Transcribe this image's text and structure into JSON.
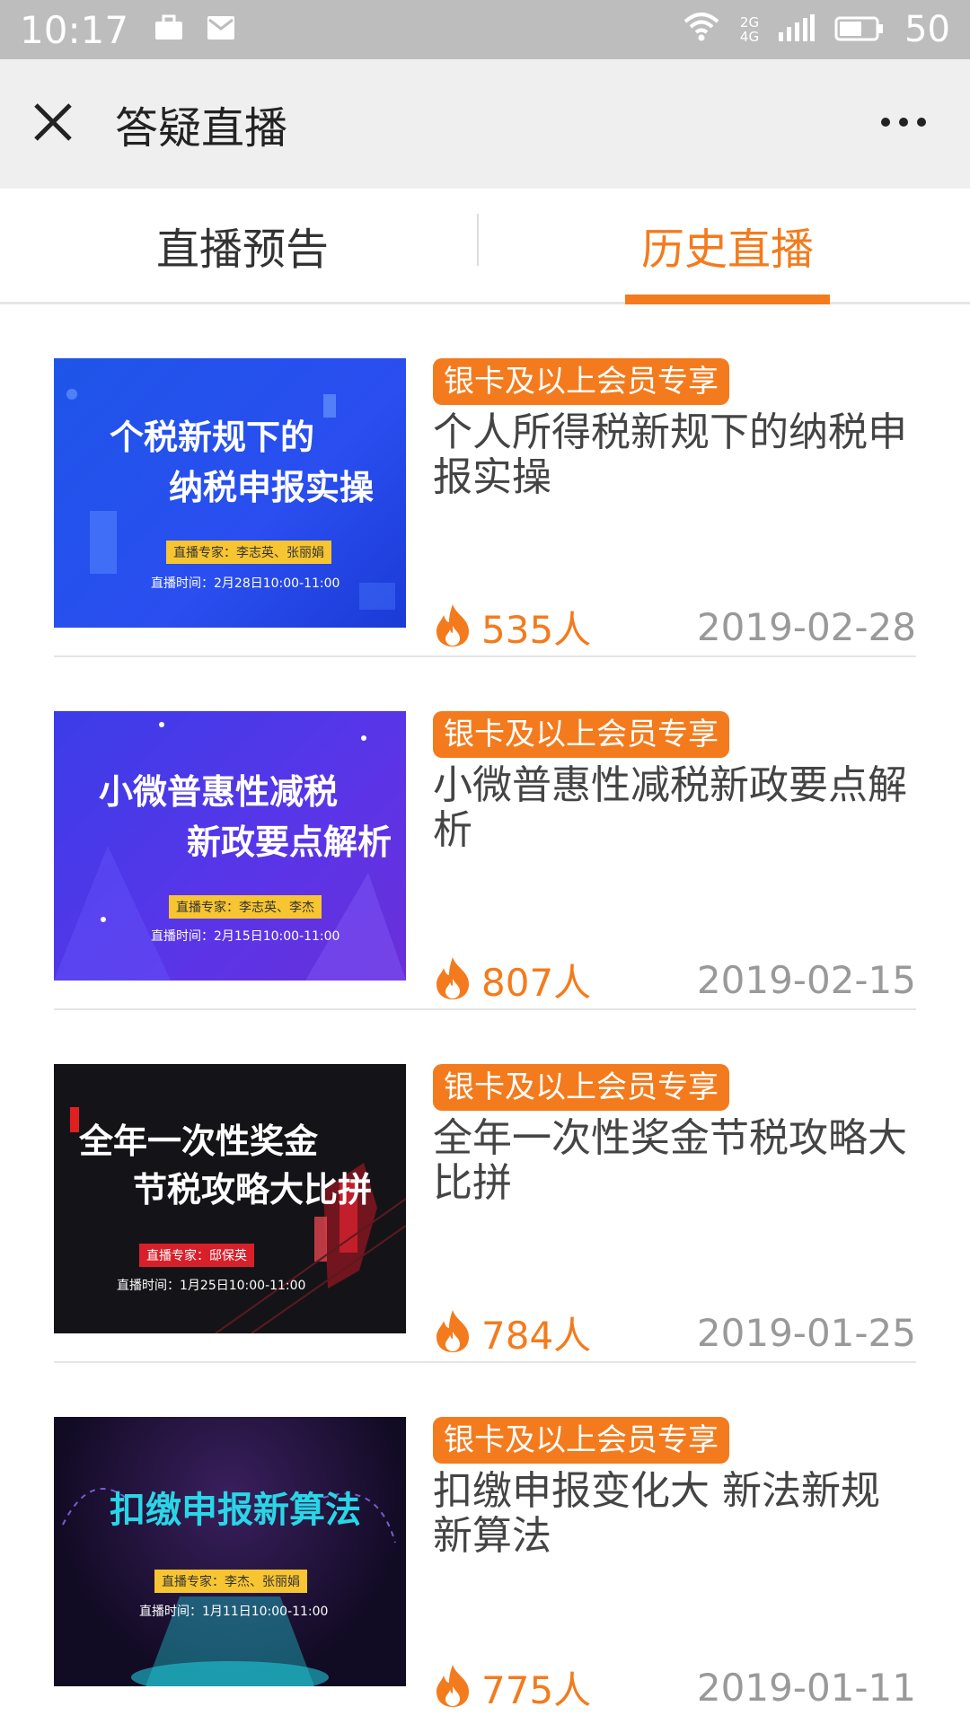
{
  "status": {
    "time": "10:17",
    "network": "2G\n4G",
    "battery": "50"
  },
  "header": {
    "title": "答疑直播"
  },
  "tabs": [
    {
      "label": "直播预告",
      "active": false
    },
    {
      "label": "历史直播",
      "active": true
    }
  ],
  "items": [
    {
      "thumb_title_1": "个税新规下的",
      "thumb_title_2": "纳税申报实操",
      "thumb_expert": "直播专家：李志英、张丽娟",
      "thumb_time": "直播时间：2月28日10:00-11:00",
      "badge": "银卡及以上会员专享",
      "title": "个人所得税新规下的纳税申报实操",
      "views": "535人",
      "date": "2019-02-28"
    },
    {
      "thumb_title_1": "小微普惠性减税",
      "thumb_title_2": "新政要点解析",
      "thumb_expert": "直播专家：李志英、李杰",
      "thumb_time": "直播时间：2月15日10:00-11:00",
      "badge": "银卡及以上会员专享",
      "title": "小微普惠性减税新政要点解析",
      "views": "807人",
      "date": "2019-02-15"
    },
    {
      "thumb_title_1": "全年一次性奖金",
      "thumb_title_2": "节税攻略大比拼",
      "thumb_expert": "直播专家：邸保英",
      "thumb_time": "直播时间：1月25日10:00-11:00",
      "badge": "银卡及以上会员专享",
      "title": "全年一次性奖金节税攻略大比拼",
      "views": "784人",
      "date": "2019-01-25"
    },
    {
      "thumb_title_1": "扣缴申报新算法",
      "thumb_title_2": "",
      "thumb_expert": "直播专家：李杰、张丽娟",
      "thumb_time": "直播时间：1月11日10:00-11:00",
      "badge": "银卡及以上会员专享",
      "title": "扣缴申报变化大 新法新规新算法",
      "views": "775人",
      "date": "2019-01-11"
    }
  ],
  "colors": {
    "accent": "#f37b1d",
    "badge_bg": "#f37b1d",
    "date": "#999999"
  },
  "icons": {
    "close": "close-icon",
    "more": "more-icon",
    "views": "flame-icon"
  }
}
